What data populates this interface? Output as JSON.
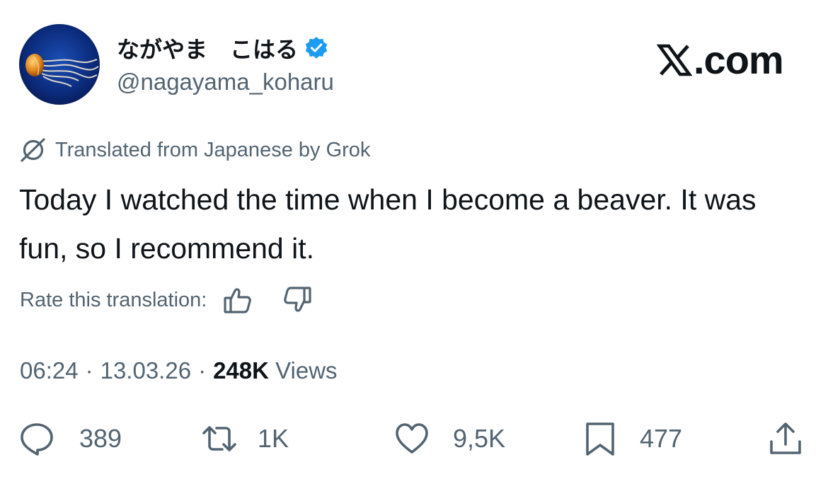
{
  "author": {
    "display_name": "ながやま　こはる",
    "verified": true,
    "handle": "@nagayama_koharu",
    "avatar_icon": "jellyfish-avatar"
  },
  "site": {
    "logo_text": ".com",
    "logo_icon": "x-logo-icon"
  },
  "translation": {
    "icon": "grok-icon",
    "note": "Translated from Japanese by Grok",
    "rate_label": "Rate this translation:"
  },
  "tweet": {
    "text": "Today I watched the time when I become a beaver. It was fun, so I recommend it."
  },
  "meta": {
    "time": "06:24",
    "separator": "·",
    "date": "13.03.26",
    "views_count": "248K",
    "views_label": "Views"
  },
  "actions": {
    "replies": "389",
    "reposts": "1K",
    "likes": "9,5K",
    "bookmarks": "477"
  },
  "colors": {
    "text_primary": "#0f1419",
    "text_secondary": "#536471",
    "verified_blue": "#1d9bf0",
    "background": "#ffffff"
  }
}
